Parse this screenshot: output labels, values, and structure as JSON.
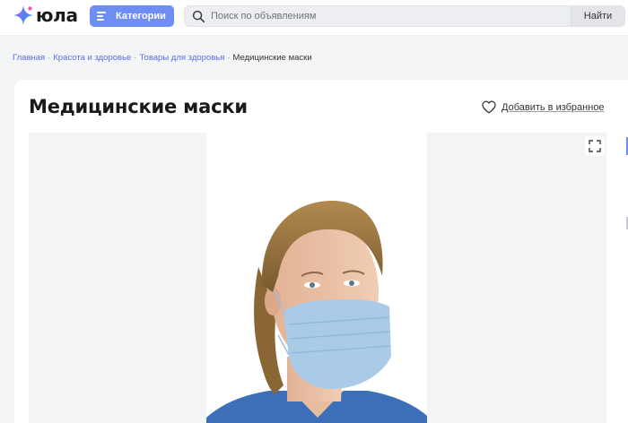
{
  "header": {
    "logo_text": "юла",
    "categories_label": "Категории",
    "search_placeholder": "Поиск по объявлениям",
    "search_value": "",
    "find_label": "Найти"
  },
  "breadcrumb": [
    {
      "label": "Главная"
    },
    {
      "label": "Красота и здоровье"
    },
    {
      "label": "Товары для здоровья"
    },
    {
      "label": "Медицинские маски"
    }
  ],
  "breadcrumb_separator": "·",
  "listing": {
    "title": "Медицинские маски",
    "favorite_label": "Добавить в избранное",
    "photo_icon": "product-photo",
    "expand_icon": "expand-icon"
  },
  "colors": {
    "accent": "#6f8ef5",
    "link": "#5b6fd6",
    "page_bg": "#f4f5f7",
    "mask": "#a9cbe8",
    "scrubs": "#3d6fb8"
  }
}
